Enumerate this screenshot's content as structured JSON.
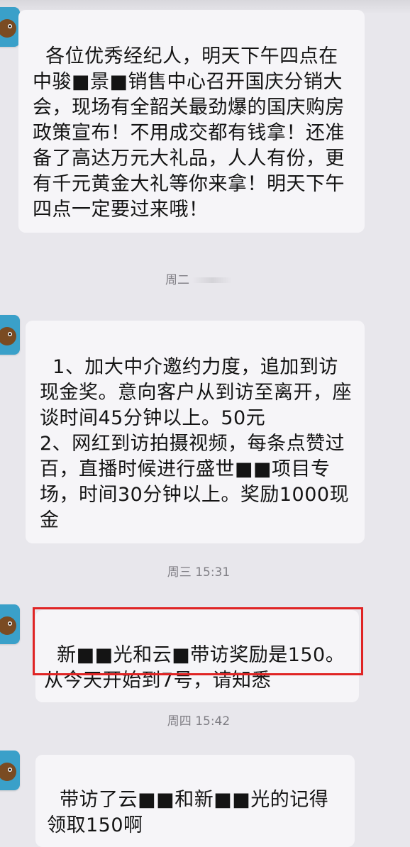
{
  "chat": {
    "messages": [
      {
        "sender_avatar": "cartoon-dog-avatar",
        "text": "各位优秀经纪人，明天下午四点在中骏■景■销售中心召开国庆分销大会，现场有全韶关最劲爆的国庆购房政策宣布！不用成交都有钱拿！还准备了高达万元大礼品，人人有份，更有千元黄金大礼等你来拿！明天下午四点一定要过来哦！"
      },
      {
        "timestamp": "周二"
      },
      {
        "sender_avatar": "cartoon-dog-avatar",
        "text": "1、加大中介邀约力度，追加到访现金奖。意向客户从到访至离开，座谈时间45分钟以上。50元\n2、网红到访拍摄视频，每条点赞过百，直播时候进行盛世■■项目专场，时间30分钟以上。奖励1000现金"
      },
      {
        "timestamp": "周三 15:31"
      },
      {
        "sender_avatar": "cartoon-dog-avatar",
        "text": "新■■光和云■带访奖励是150。从今天开始到7号，请知悉",
        "highlighted": true
      },
      {
        "timestamp": "周四 15:42"
      },
      {
        "sender_avatar": "cartoon-dog-avatar",
        "text": "带访了云■■和新■■光的记得领取150啊"
      }
    ]
  },
  "colors": {
    "background": "#e8e7ec",
    "bubble": "#f6f5f8",
    "highlight_border": "#e02424",
    "timestamp": "#7f7e84"
  }
}
